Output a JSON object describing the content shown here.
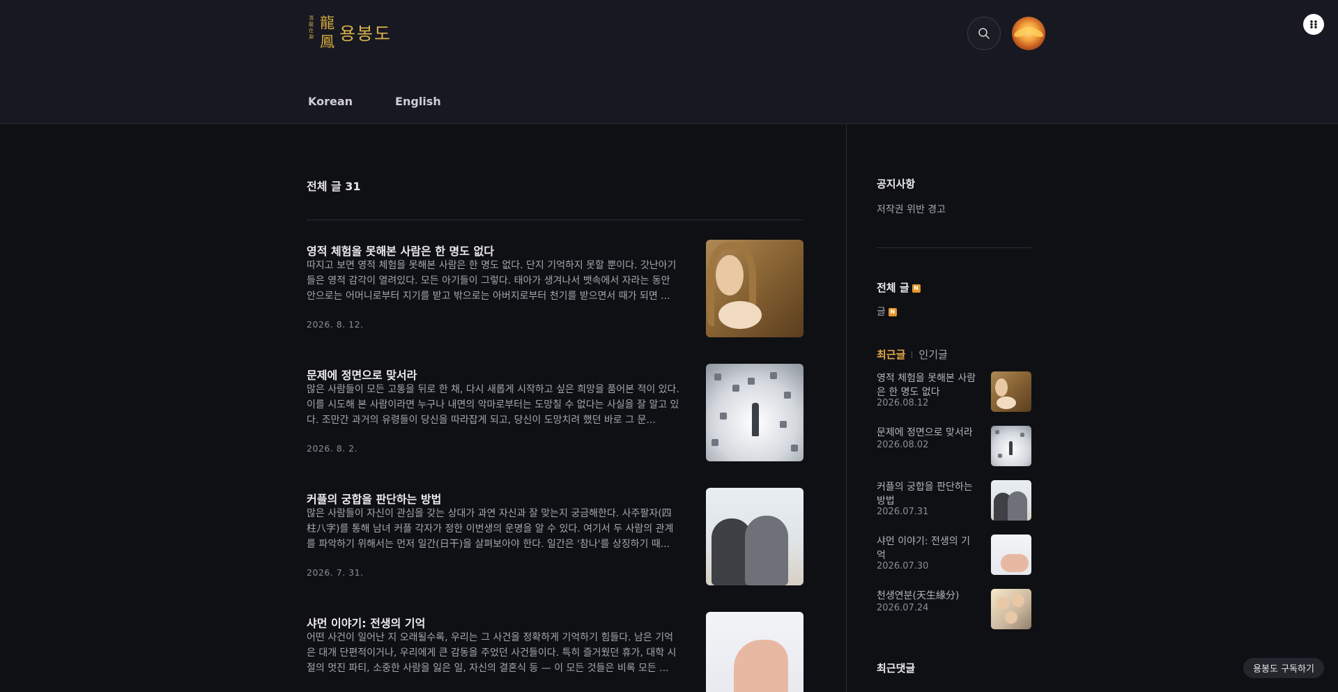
{
  "header": {
    "logo": {
      "seal_small": "潛龍在淵",
      "seal_big": "龍鳳",
      "name": "용봉도"
    },
    "search_icon": "search-icon",
    "avatar_icon": "phoenix-avatar",
    "menu_icon": "more-dots-icon"
  },
  "nav": {
    "items": [
      {
        "label": "Korean"
      },
      {
        "label": "English"
      }
    ]
  },
  "main": {
    "count_title": "전체 글 31",
    "posts": [
      {
        "title": "영적 체험을 못해본 사람은 한 명도 없다",
        "excerpt": "따지고 보면 영적 체험을 못해본 사람은 한 명도 없다. 단지 기억하지 못할 뿐이다. 갓난아기들은 영적 감각이 열려있다. 모든 아기들이 그렇다. 태아가 생겨나서 뱃속에서 자라는 동안 안으로는 어머니로부터 지기를 받고 밖으로는 아버지로부터 천기를 받으면서 때가 되면 ...",
        "date": "2026. 8. 12."
      },
      {
        "title": "문제에 정면으로 맞서라",
        "excerpt": "많은 사람들이 모든 고통을 뒤로 한 채, 다시 새롭게 시작하고 싶은 희망을 품어본 적이 있다. 이를 시도해 본 사람이라면 누구나 내면의 악마로부터는 도망칠 수 없다는 사실을 잘 알고 있다. 조만간 과거의 유령들이 당신을 따라잡게 되고, 당신이 도망치려 했던 바로 그 문...",
        "date": "2026. 8. 2."
      },
      {
        "title": "커플의 궁합을 판단하는 방법",
        "excerpt": "많은 사람들이 자신이 관심을 갖는 상대가 과연 자신과 잘 맞는지 궁금해한다. 사주팔자(四柱八字)를 통해 남녀 커플 각자가 정한 이번생의 운명을 알 수 있다. 여기서 두 사람의 관계를 파악하기 위해서는 먼저 일간(日干)을 살펴보아야 한다. 일간은 '참나'를 상징하기 때...",
        "date": "2026. 7. 31."
      },
      {
        "title": "샤먼 이야기: 전생의 기억",
        "excerpt": "어떤 사건이 일어난 지 오래될수록, 우리는 그 사건을 정확하게 기억하기 힘들다. 남은 기억은 대개 단편적이거나, 우리에게 큰 감동을 주었던 사건들이다. 특히 즐거웠던 휴가, 대학 시절의 멋진 파티, 소중한 사람을 잃은 일, 자신의 결혼식 등 — 이 모든 것들은 비록 모든 ...",
        "date": ""
      }
    ]
  },
  "sidebar": {
    "notice_heading": "공지사항",
    "notice_link": "저작권 위반 경고",
    "all_posts_heading": "전체 글",
    "category_link": "글",
    "new_badge": "N",
    "tabs": {
      "recent": "최근글",
      "popular": "인기글"
    },
    "recent_posts": [
      {
        "title": "영적 체험을 못해본 사람은 한 명도 없다",
        "date": "2026.08.12"
      },
      {
        "title": "문제에 정면으로 맞서라",
        "date": "2026.08.02"
      },
      {
        "title": "커플의 궁합을 판단하는 방법",
        "date": "2026.07.31"
      },
      {
        "title": "샤먼 이야기: 전생의 기억",
        "date": "2026.07.30"
      },
      {
        "title": "천생연분(天生緣分)",
        "date": "2026.07.24"
      }
    ],
    "recent_comments_heading": "최근댓글"
  },
  "subscribe_label": "용봉도 구독하기",
  "colors": {
    "background": "#0f1014",
    "header": "#171821",
    "accent": "#e3a94a",
    "logo_gold": "#d9b24a",
    "badge": "#e3952a"
  }
}
